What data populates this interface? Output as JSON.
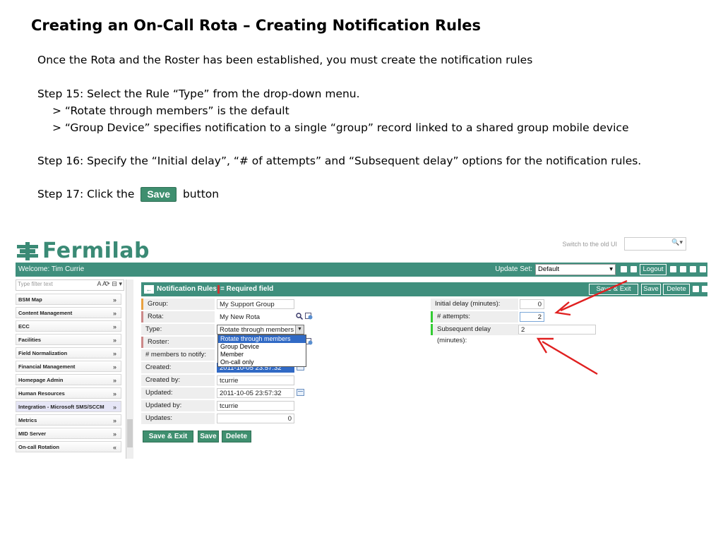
{
  "slide": {
    "title": "Creating an On-Call Rota – Creating Notification Rules",
    "intro": "Once the Rota and the Roster has been established, you must create the notification rules",
    "step15": "Step 15: Select the Rule “Type” from the drop-down menu.",
    "step15_a": "> “Rotate through members” is the default",
    "step15_b": "> “Group Device” specifies notification to a single “group” record linked to a shared group mobile device",
    "step16": "Step 16: Specify the “Initial delay”, “# of attempts” and “Subsequent delay” options for the notification rules.",
    "step17_pre": "Step 17: Click the",
    "step17_btn": "Save",
    "step17_post": "button"
  },
  "app": {
    "logo": "Fermilab",
    "switch_ui": "Switch to the old UI",
    "welcome": "Welcome: Tim Currie",
    "update_set_label": "Update Set:",
    "update_set_value": "Default",
    "logout": "Logout"
  },
  "nav": {
    "filter_placeholder": "Type filter text",
    "font_controls": "A A",
    "items": [
      {
        "label": "BSM Map"
      },
      {
        "label": "Content Management"
      },
      {
        "label": "ECC"
      },
      {
        "label": "Facilities"
      },
      {
        "label": "Field Normalization"
      },
      {
        "label": "Financial Management"
      },
      {
        "label": "Homepage Admin"
      },
      {
        "label": "Human Resources"
      },
      {
        "label": "Integration - Microsoft SMS/SCCM"
      },
      {
        "label": "Metrics"
      },
      {
        "label": "MID Server"
      },
      {
        "label": "On-call Rotation"
      }
    ]
  },
  "form": {
    "title": "Notification Rules",
    "required": "= Required field",
    "btn_save_exit": "Save & Exit",
    "btn_save": "Save",
    "btn_delete": "Delete",
    "fields": {
      "group_label": "Group:",
      "group_value": "My Support Group",
      "rota_label": "Rota:",
      "rota_value": "My New Rota",
      "type_label": "Type:",
      "type_value": "Rotate through members",
      "roster_label": "Roster:",
      "members_label": "# members to notify:",
      "created_label": "Created:",
      "created_value": "2011-10-05 23:57:32",
      "created_by_label": "Created by:",
      "created_by_value": "tcurrie",
      "updated_label": "Updated:",
      "updated_value": "2011-10-05 23:57:32",
      "updated_by_label": "Updated by:",
      "updated_by_value": "tcurrie",
      "updates_label": "Updates:",
      "updates_value": "0",
      "initial_delay_label": "Initial delay (minutes):",
      "initial_delay_value": "0",
      "attempts_label": "# attempts:",
      "attempts_value": "2",
      "subsequent_delay_label": "Subsequent delay (minutes):",
      "subsequent_delay_value": "2"
    },
    "type_options": [
      "Rotate through members",
      "Group Device",
      "Member",
      "On-call only"
    ]
  },
  "colors": {
    "brand": "#3f8f7d",
    "arrow": "#e02020"
  }
}
